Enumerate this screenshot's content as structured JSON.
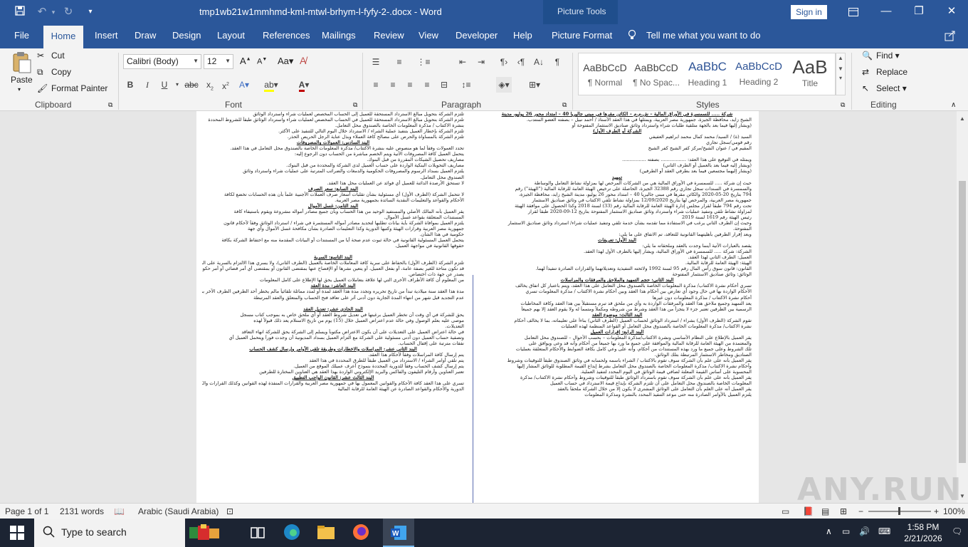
{
  "titlebar": {
    "doc_title": "tmp1wb21w1mmhmd-kml-mtwl-brhym-l-fyfy-2-.docx - Word",
    "contextual_tab_group": "Picture Tools",
    "signin_label": "Sign in"
  },
  "tabs": [
    "File",
    "Home",
    "Insert",
    "Draw",
    "Design",
    "Layout",
    "References",
    "Mailings",
    "Review",
    "View",
    "Developer",
    "Help",
    "Picture Format"
  ],
  "tell_me": "Tell me what you want to do",
  "ribbon": {
    "clipboard": {
      "paste": "Paste",
      "cut": "Cut",
      "copy": "Copy",
      "format_painter": "Format Painter",
      "label": "Clipboard"
    },
    "font": {
      "name": "Calibri (Body)",
      "size": "12",
      "label": "Font"
    },
    "paragraph": {
      "label": "Paragraph"
    },
    "styles": {
      "label": "Styles",
      "items": [
        {
          "preview": "AaBbCcD",
          "name": "¶ Normal"
        },
        {
          "preview": "AaBbCcD",
          "name": "¶ No Spac..."
        },
        {
          "preview": "AaBbC",
          "name": "Heading 1"
        },
        {
          "preview": "AaBbCcD",
          "name": "Heading 2"
        },
        {
          "preview": "AaB",
          "name": "Title"
        }
      ]
    },
    "editing": {
      "find": "Find",
      "replace": "Replace",
      "select": "Select",
      "label": "Editing"
    }
  },
  "document": {
    "left_column": [
      "تلتزم الشركة بتحويل مبالغ الاسترداد المستحقة للعميل إلى الحساب المخصص لعمليات شراء واسترداد الوثائق",
      "تلتزم الشركة بتحويل مبالغ الاسترداد المستحقة للعميل في الحساب المخصص لعمليات شراء واسترداد الوثائق طبقاً للشروط المحددة",
      "بنشرة الاكتتاب / مذكرة المعلومات الخاصة بالصندوق محل التعامل.",
      "تلتزم الشركة بإخطار العميل بتنفيذ عملية الشراء / الاسترداد خلال اليوم التالي للتنفيذ على الأكثر.",
      "تلتزم الشركة بالمساواة والحرص على مصالح كافة العملاء وبذل عناية الرجل الحريص الحذر.",
      "@البند السادس: العمولات والمصروفات",
      "تحدد العمولات وفقاً لما هو منصوص عليه بنشرة الاكتتاب/ مذكرة المعلومات الخاصة بالصندوق محل التعامل في هذا العقد.",
      "يتحمل العميل كافة المصروفات الآتية ويتم الخصم مباشرة من الحساب دون الرجوع إليه:",
      "مصاريف تحصيل الشيكات المقررة من قبل البنوك.",
      "مصاريف التحويلات البنكية الواردة على حساب العميل لدى الشركة والمحددة من قبل البنوك.",
      "يلتزم العميل بسداد الرسوم والمصروفات الحكومية والدمغات والضرائب المترتبة على عمليات شراء واسترداد وثائق",
      "الصندوق محل التعامل.",
      "لا تستحق الأرصدة الدائنة للعميل أي فوائد عن العمليات محل هذا العقد.",
      "@البند السابع: سعر الصرف",
      "لا تتحمل الشركة (الطرف الأول) أي مسئولية بشأن تقلبات أسعار صرف العملات الأجنبية علماً بأن هذه الحسابات تخضع لكافة",
      "الأحكام والقواعد والتعليمات النقدية السائدة بجمهورية مصر العربية.",
      "@البند الثامن: غسل الأموال",
      "يقر العميل بأنه المالك الأصلي والمستفيد الوحيد من هذا الحساب وبأن جميع مصادر أمواله مشروعة ويقوم باستيفاء كافة",
      "المستندات المتعلقة بقواعد غسل الأموال.",
      "يلتزم العميل بموافاة الشركة بأية بيانات تطلبها لتحديد مصادر أمواله المستثمرة في شراء / استرداد الوثائق وفقاً لأحكام قانون",
      "جمهورية مصر العربية وقرارات الهيئة وكتبها الدورية وكذا التعليمات الصادرة بشأن مكافحة غسل الأموال وأي جهة",
      "حكومية في هذا الشأن.",
      "يتحمل العميل المسئولية القانونية في حالة ثبوت عدم صحة أيا من المستندات أو البيانات المقدمة منه مع احتفاظ الشركة بكافة",
      "حقوقها القانونية في مواجهة العميل.",
      "",
      "@البند التاسع: السرية",
      "تلتزم الشركة (الطرف الأول) بالحفاظ على سرية كافة المعاملات الخاصة بالعميل (الطرف الثاني)، ولا يسري هذا الالتزام بالسرية على المعلومات التي",
      "قد تكون متاحة للغير بصفة عامة، أو بفعل العميل، أو يتعين نشرها أو الإفصاح عنها بمقتضى القانون أو بمقتضى أي أمر قضائي أو أمر حكومي أو أمر",
      "يصدر عن جهة ذات اختصاص.",
      "من المعلوم أن كافة الأطراف الأخرى التي لها علاقة بتعاملات العميل يحق لها الإطلاع على كامل المعلومات",
      "@البند العاشر: مدة العقد",
      "مدة هذا العقد سنة ميلادية تبدأ من تاريخ تحريره وتجدد مدة هذا العقد لمدة أو لمدد مماثلة تلقائياً مالم يخطر أحد الطرفين الطرف الآخر برغبته في",
      "عدم التجديد قبل شهر من انتهاء المدة الجارية دون أدنى أثر على تعاقد فتح الحساب والمتعلق والعقد المرتبطة",
      "",
      "@البند الحادي عشر: تعديل العقد",
      "يحق للشركة في أي وقت أن تخطر العميل برغبتها في تعديل شروط العقد أو أي ملحق خاص به بموجب كتاب مسجل",
      "موصى عليه بعلم الوصول وفي حالة عدم اعتراض العميل خلال (15) يوم من تاريخ الاستلام يعد ذلك قبولاً لهذه",
      "التعديلات.",
      "في حالة اعتراض العميل على التعديلات على أن يكون الاعتراض مكتوباً ويسلم إلى الشركة يحق للشركة انهاء التعاقد",
      "وتصفية حساب العميل دون أدنى مسئولية على الشركة مع التزام العميل بسداد المديونية أن وجدت فوراً ويتحمل العميل أي",
      "نفقات مترتبة على إقفال الحساب.",
      "@البند الثاني عشر: المراسلات والاخطارات وطريقة تلقي الأوامر وإرسال كشف الحساب",
      "يتم إرسال كافة المراسلات وفقاً لأحكام هذا العقد.",
      "يتم تلقي أوامر الشراء / الاسترداد من العميل طبقاً للطرق المحددة في هذا العقد",
      "يتم إرسال كشف الحساب وفقاً للدورية المحددة بنموذج أعرف عميلك الموقع من العميل.",
      "تعتبر العناوين وأرقام التليفون والفاكس والبريد الإلكتروني الواردة بهذا العقد هي العناوين المختارة للطرفين",
      "@البند الثالث عشر: القانون الواجب التطبيق",
      "تسري على هذا العقد كافة الأحكام والقوانين المعمول بها في جمهورية مصر العربية والقرارات المنفذة لهذه القوانين وكذلك القرارات والكتب",
      "الدورية والأحكام والقواعد الصادرة عن الهيئة العامة للرقابة المالية"
    ],
    "right_column": [
      "@شركة ..... للسمسرة في الأوراق المالية – ش.م.م – الكائن مقرها في مبنى جاليريا 40 – امتداد محور 26 يوليو، مدينة",
      "الشيخ زايد، محافظة الجيزة، جمهورية مصر العربية، ويمثلها في هذا العقد الأستاذ / أحمد نبيل – بصفته العضو المنتدب.",
      "(ويشار إليها فيما بعد بالجهة متلقية طلبات شراء واسترداد وثائق صناديق الاستثمار المفتوحة أو",
      "@الشركة أو الطرف الأول)",
      "السيد (ة) / السيد/ محمد كمال محمد ابراهيم العفيفي",
      "رقم قومي/سجل تجاري",
      "المقيم في / عنوان الشيخ/مركز كفر الشيخ كفر الشيخ",
      "",
      "ويمثله في التوقيع على هذا العقد: ................. بصفته ................",
      "(ويشار إليه فيما بعد بالعميل أو الطرف الثاني)",
      "(ويشار إليهما مجتمعين فيما بعد بطرفي العقد أو الطرفين)",
      "@تمهيد",
      "حيث إن شركة ..... للسمسرة في الأوراق المالية هي من الشركات المرخص لها بمزاولة نشاط التعامل والوساطة",
      "والسمسرة في السندات سجل تجاري رقم 32388 الجيزة، الحاصلة على ترخيص الهيئة العامة للرقابة المالية (\"الهيئة\") رقم",
      "794 بتاريخ 20-05-2020 والكائن مقرها في مبنى جاليريا 40 – امتداد محور 26 يوليو، مدينة الشيخ زايد، محافظة الجيزة،",
      "جمهورية مصر العربية، والمرخص لها بتاريخ 12/09/2020 بمزاولة نشاط تلقي الاكتتاب في وثائق صناديق الاستثمار",
      "تحت رقم 794 طبقاً لقرار مجلس إدارة الهيئة العامة للرقابة المالية رقم (33) لسنة 2018 وكذا الحصول على موافقة الهيئة",
      "لمزاولة نشاط تلقي وتنفيذ عمليات شراء واسترداد وثائق صناديق الاستثمار المفتوحة بتاريخ 12-09-2020 طبقاً لقرار",
      "رئيس الهيئة رقم 1619 لسنة 2019",
      "وحيث إن الطرف الثاني يرغب في الاستفادة مما تقدمه بشأن خدمة تلقي وتنفيذ عمليات شراء/ استرداد وثائق صناديق الاستثمار",
      "المفتوحة.",
      "وبعد إقرار الطرفين بأهليتهما القانونية للتعاقد، تم الاتفاق على ما يلي:",
      "@البند الأول: تعريفات",
      "يقصد بالعبارات الآتية أينما وجدت بالعقد وملحقاته ما يلي:",
      "الشركة: شركة ..... للسمسرة في الأوراق المالية، ويشار إليها بالطرف الأول لهذا العقد.",
      "العميل: الطرف الثاني لهذا العقد.",
      "الهيئة: الهيئة العامة للرقابة المالية.",
      "القانون: قانون سوق رأس المال رقم 95 لسنة 1992 ولائحته التنفيذية وتعديلاتهما والقرارات الصادرة تنفيذاً لهما.",
      "الوثائق: وثائق صناديق الاستثمار المفتوحة",
      "@البند الثاني: حجم التمهيد والملاحق والمرفقات والمراسلات",
      "تسري أحكام نشرة الاكتتاب/ مذكرة المعلومات الخاصة بالصندوق محل التعامل على هذا العقد، ويتم باعتبار كل اتفاق يخالف",
      "الأحكام الواردة بها في حال وجود أي تعارض بين أحكام هذا العقد وبين أحكام نشرة الاكتتاب / مذكرة المعلومات تسري",
      "أحكام نشرة الاكتتاب / مذكرة المعلومات دون غيرها",
      "يعد التمهيد وجميع ملاحق هذا العقد والمرفقات الواردة به وأي من ملحق قد تبرم مستقبلاً بين هذا العقد وكافة المخاطبات",
      "الرسمية بين الطرفين تعتبر جزء لا يتجزأ من هذا العقد وشرط من شروطه ومكملاً ومتمماً له ولا يقوم العقد إلا بهم جميعاً",
      "@البند الثالث: موضوع العقد",
      "تقوم الشركة (الطرف الأول) بشراء / استرداد الوثائق لحساب العميل (الطرف الثاني) بناءاً على تعليماته، بما لا يخالف أحكام",
      "نشرة الاكتتاب/ مذكرة المعلومات الخاصة بالصندوق محل التعامل أو القواعد المنظمة لهذه العمليات",
      "@البند الرابع: إقرارات العميل",
      "يقر العميل بالإطلاع على النظام الأساسي ونشرة الاكتتاب/مذكرة المعلومات – بحسب الأحوال – للصندوق محل التعامل",
      "والمعتمدة من الهيئة العامة للرقابة المالية والموافقة على جميع ما ورد بها جميعاً من أحكام وأنه قد وعى ويوافق على",
      "تلك الشروط وعلى جميع ما ورد بهذه المستندات من أحكام، وأنه على وعي كامل بكافة الضوابط والأحكام المتعلقة بعمليات",
      "الصناديق ومخاطر الاستثمار المرتبطة بتلك الوثائق.",
      "يقر العميل بأنه على علم بأن الشركة سوف تقوم بالاكتتاب / الشراء باسمه ولحسابه في وثائق الصندوق طبقاً للتوقيتات وشروط",
      "وأحكام نشرة الاكتتاب/ مذكرة المعلومات الخاصة بالصندوق محل التعامل بشرط إيداع القيمة المطلوبة للوثائق المشار إليها",
      "المحسوبة على أساس القيمة المعلنة لصافي قيمة الوثائق في اليوم المحدد لتنفيذ العملية.",
      "يقر العميل بأنه على علم بأن الشركة سوف تقوم باسترداد الوثائق طبقاً للتوقيتات وشروط وأحكام نشرة الاكتتاب/ مذكرة",
      "المعلومات الخاصة بالصندوق محل التعامل على أن تلتزم الشركة بإيداع قيمة الاسترداد في حساب العميل",
      "يقر العميل أنه على العلم بأن التعامل على الوثائق المشترى لا يكون إلا من خلال الشركة ملحقاً بالعقد",
      "يلتزم العميل بالأوامر الصادرة منه حتى موعد التنفيذ المحدد بالنشرة ومذكرة المعلومات"
    ],
    "watermark": "ANY.RUN"
  },
  "statusbar": {
    "page": "Page 1 of 1",
    "words": "2131 words",
    "language": "Arabic (Saudi Arabia)",
    "zoom": "100%"
  },
  "taskbar": {
    "search_placeholder": "Type to search",
    "time": "1:58 PM",
    "date": "2/21/2026"
  }
}
